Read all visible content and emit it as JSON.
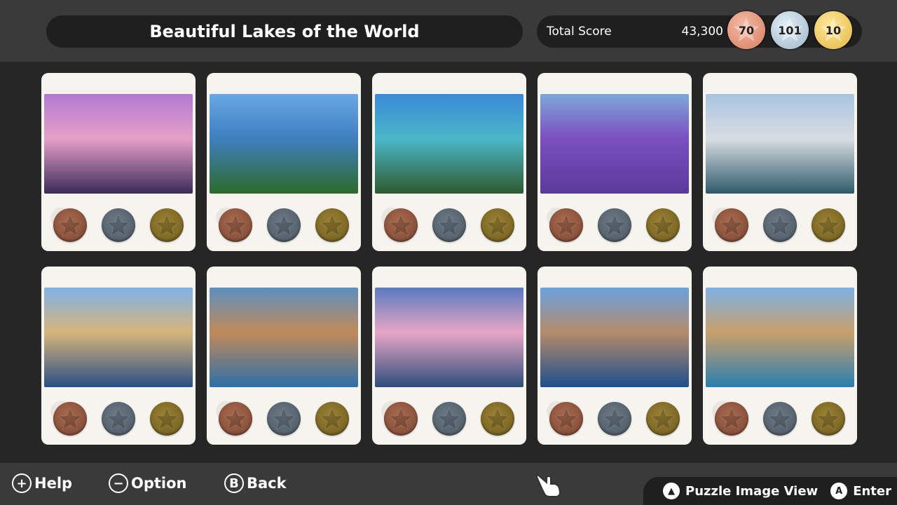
{
  "header": {
    "title": "Beautiful Lakes of the World",
    "total_score_label": "Total Score",
    "total_score_value": "43,300",
    "medals": [
      {
        "type": "bronze",
        "count": "70"
      },
      {
        "type": "silver",
        "count": "101"
      },
      {
        "type": "gold",
        "count": "10"
      }
    ]
  },
  "puzzles": [
    {
      "name": "puzzle-1",
      "colors": [
        "#b07ad0",
        "#e6a0c8",
        "#3a2a58"
      ]
    },
    {
      "name": "puzzle-2",
      "colors": [
        "#6aa7e6",
        "#3f7fbf",
        "#2d6a2a"
      ]
    },
    {
      "name": "puzzle-3",
      "colors": [
        "#3a8ad6",
        "#4bb7c8",
        "#2e5a30"
      ]
    },
    {
      "name": "puzzle-4",
      "colors": [
        "#7ea8d8",
        "#7b4fc0",
        "#5b3a9a"
      ]
    },
    {
      "name": "puzzle-5",
      "colors": [
        "#a9c4e0",
        "#d8dde2",
        "#2f5a6a"
      ]
    },
    {
      "name": "puzzle-6",
      "colors": [
        "#7fb2e6",
        "#d6b57a",
        "#2a4f86"
      ]
    },
    {
      "name": "puzzle-7",
      "colors": [
        "#5d8fbf",
        "#c08a5a",
        "#2e6fa8"
      ]
    },
    {
      "name": "puzzle-8",
      "colors": [
        "#5a79c0",
        "#e7a6c6",
        "#2d4d7a"
      ]
    },
    {
      "name": "puzzle-9",
      "colors": [
        "#6aa2e0",
        "#b48b6a",
        "#1e4f8c"
      ]
    },
    {
      "name": "puzzle-10",
      "colors": [
        "#7db0e6",
        "#c9a06a",
        "#2a7fb0"
      ]
    }
  ],
  "footer": {
    "help_glyph": "+",
    "help_label": "Help",
    "option_glyph": "−",
    "option_label": "Option",
    "back_glyph": "B",
    "back_label": "Back",
    "puzzle_view_glyph": "▲",
    "puzzle_view_label": "Puzzle Image View",
    "enter_glyph": "A",
    "enter_label": "Enter"
  },
  "icons": {
    "medal_slot": "star-icon",
    "pointer": "hand-pointer-icon"
  }
}
